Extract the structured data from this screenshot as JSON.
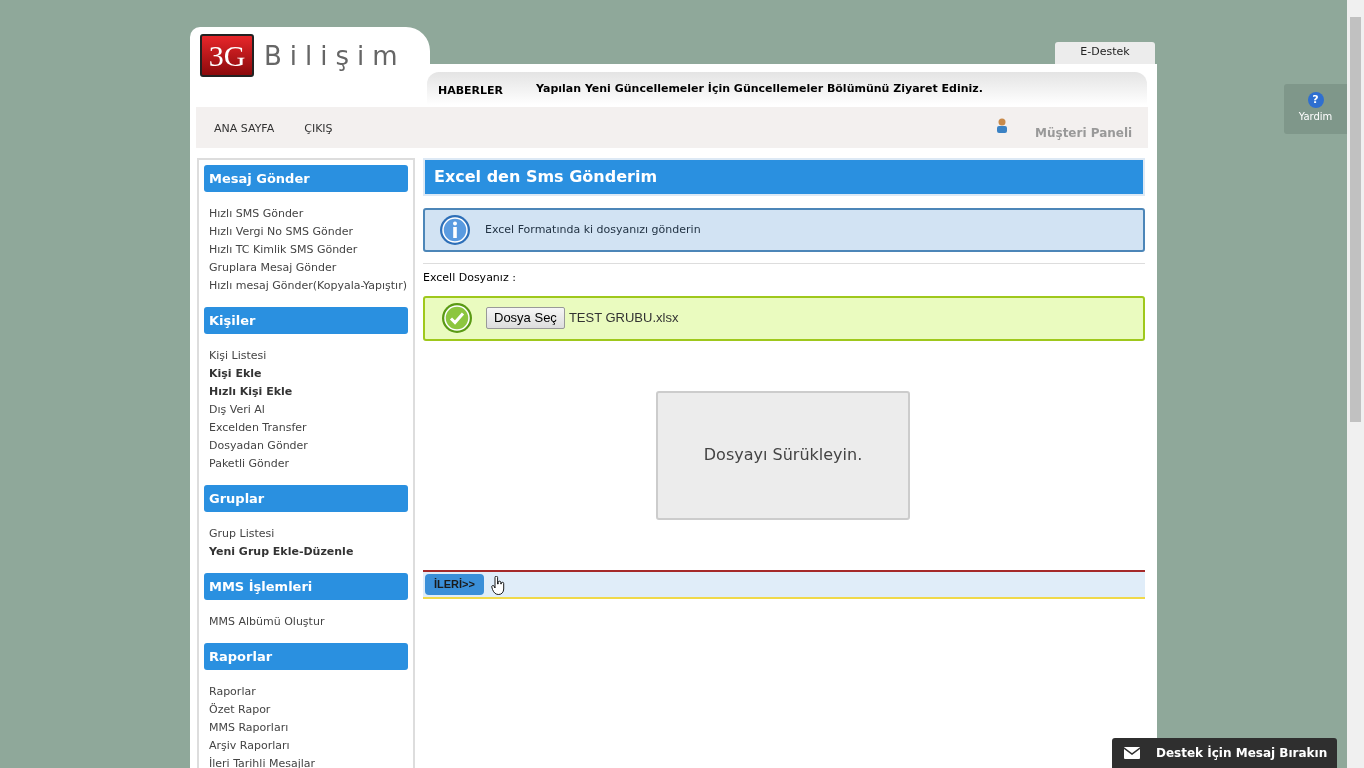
{
  "logo": {
    "badge": "3G",
    "name": "Bilişim"
  },
  "edestek_tab": "E-Destek",
  "news": {
    "label": "HABERLER",
    "text": "Yapılan Yeni Güncellemeler İçin Güncellemeler Bölümünü Ziyaret Ediniz."
  },
  "nav": {
    "items": [
      "ANA SAYFA",
      "ÇIKIŞ"
    ],
    "panel": "Müşteri Paneli"
  },
  "help_button": {
    "icon": "?",
    "label": "Yardim"
  },
  "sidebar": {
    "sections": [
      {
        "title": "Mesaj Gönder",
        "items": [
          {
            "label": "Hızlı SMS Gönder",
            "bold": false
          },
          {
            "label": "Hızlı Vergi No SMS Gönder",
            "bold": false
          },
          {
            "label": "Hızlı TC Kimlik SMS Gönder",
            "bold": false
          },
          {
            "label": "Gruplara Mesaj Gönder",
            "bold": false
          },
          {
            "label": "Hızlı mesaj Gönder(Kopyala-Yapıştır)",
            "bold": false
          }
        ]
      },
      {
        "title": "Kişiler",
        "items": [
          {
            "label": "Kişi Listesi",
            "bold": false
          },
          {
            "label": "Kişi Ekle",
            "bold": true
          },
          {
            "label": "Hızlı Kişi Ekle",
            "bold": true
          },
          {
            "label": "Dış Veri Al",
            "bold": false
          },
          {
            "label": "Excelden Transfer",
            "bold": false
          },
          {
            "label": "Dosyadan Gönder",
            "bold": false
          },
          {
            "label": "Paketli Gönder",
            "bold": false
          }
        ]
      },
      {
        "title": "Gruplar",
        "items": [
          {
            "label": "Grup Listesi",
            "bold": false
          },
          {
            "label": "Yeni Grup Ekle-Düzenle",
            "bold": true
          }
        ]
      },
      {
        "title": "MMS İşlemleri",
        "items": [
          {
            "label": "MMS Albümü Oluştur",
            "bold": false
          }
        ]
      },
      {
        "title": "Raporlar",
        "items": [
          {
            "label": "Raporlar",
            "bold": false
          },
          {
            "label": "Özet Rapor",
            "bold": false
          },
          {
            "label": "MMS Raporları",
            "bold": false
          },
          {
            "label": "Arşiv Raporları",
            "bold": false
          },
          {
            "label": "İleri Tarihli Mesajlar",
            "bold": false
          }
        ]
      }
    ]
  },
  "content": {
    "title": "Excel den Sms Gönderim",
    "info": "Excel Formatında ki dosyanızı gönderin",
    "file_label": "Excell Dosyanız :",
    "file_button": "Dosya Seç",
    "file_name": "TEST GRUBU.xlsx",
    "dropzone": "Dosyayı Sürükleyin.",
    "next_button": "İLERİ>>"
  },
  "chat_bar": "Destek İçin Mesaj Bırakın"
}
